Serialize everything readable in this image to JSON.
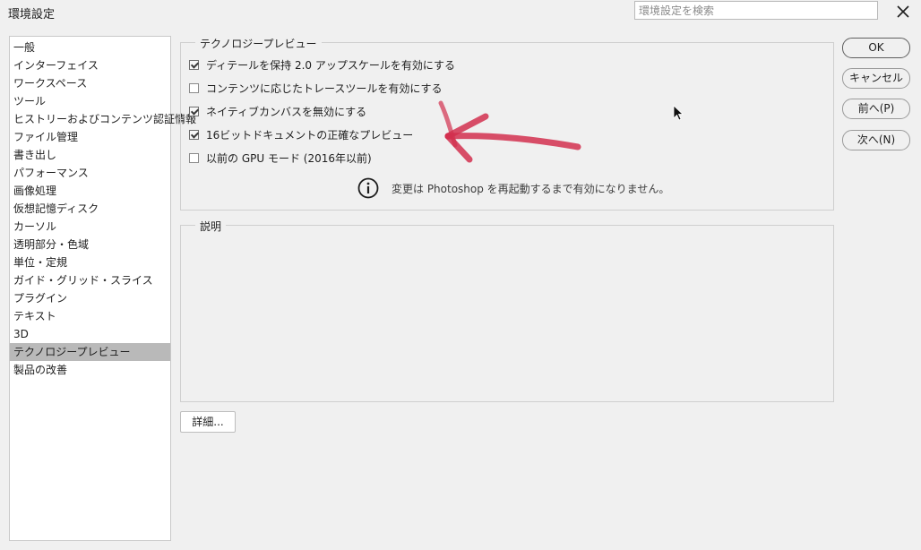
{
  "window": {
    "title": "環境設定",
    "search_placeholder": "環境設定を検索",
    "close_icon": "close-icon"
  },
  "sidebar": {
    "items": [
      {
        "label": "一般",
        "selected": false
      },
      {
        "label": "インターフェイス",
        "selected": false
      },
      {
        "label": "ワークスペース",
        "selected": false
      },
      {
        "label": "ツール",
        "selected": false
      },
      {
        "label": "ヒストリーおよびコンテンツ認証情報",
        "selected": false
      },
      {
        "label": "ファイル管理",
        "selected": false
      },
      {
        "label": "書き出し",
        "selected": false
      },
      {
        "label": "パフォーマンス",
        "selected": false
      },
      {
        "label": "画像処理",
        "selected": false
      },
      {
        "label": "仮想記憶ディスク",
        "selected": false
      },
      {
        "label": "カーソル",
        "selected": false
      },
      {
        "label": "透明部分・色域",
        "selected": false
      },
      {
        "label": "単位・定規",
        "selected": false
      },
      {
        "label": "ガイド・グリッド・スライス",
        "selected": false
      },
      {
        "label": "プラグイン",
        "selected": false
      },
      {
        "label": "テキスト",
        "selected": false
      },
      {
        "label": "3D",
        "selected": false
      },
      {
        "label": "テクノロジープレビュー",
        "selected": true
      },
      {
        "label": "製品の改善",
        "selected": false
      }
    ]
  },
  "tech_preview": {
    "legend": "テクノロジープレビュー",
    "options": [
      {
        "label": "ディテールを保持 2.0 アップスケールを有効にする",
        "checked": true
      },
      {
        "label": "コンテンツに応じたトレースツールを有効にする",
        "checked": false
      },
      {
        "label": "ネイティブカンバスを無効にする",
        "checked": true
      },
      {
        "label": "16ビットドキュメントの正確なプレビュー",
        "checked": true
      },
      {
        "label": "以前の GPU モード (2016年以前)",
        "checked": false
      }
    ],
    "notice": "変更は Photoshop を再起動するまで有効になりません。",
    "notice_icon": "info-icon"
  },
  "description": {
    "legend": "説明"
  },
  "buttons": {
    "ok": "OK",
    "cancel": "キャンセル",
    "prev": "前へ(P)",
    "next": "次へ(N)",
    "details": "詳細..."
  },
  "annotation": {
    "color": "#d2304f",
    "icon": "red-arrow-annotation-icon"
  }
}
